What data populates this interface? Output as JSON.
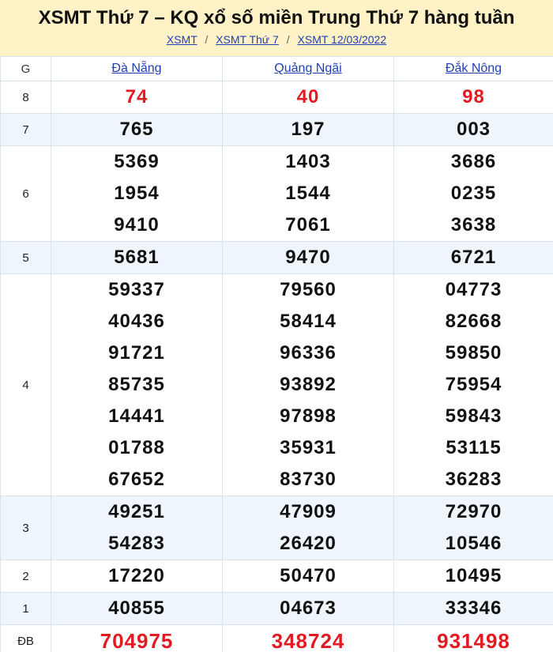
{
  "header": {
    "title": "XSMT Thứ 7 – KQ xổ số miền Trung Thứ 7 hàng tuần",
    "breadcrumbs": [
      "XSMT",
      "XSMT Thứ 7",
      "XSMT 12/03/2022"
    ],
    "separator": "/"
  },
  "table": {
    "prize_header": "G",
    "provinces": [
      "Đà Nẵng",
      "Quảng Ngãi",
      "Đắk Nông"
    ],
    "rows": [
      {
        "label": "8",
        "values": [
          [
            "74"
          ],
          [
            "40"
          ],
          [
            "98"
          ]
        ]
      },
      {
        "label": "7",
        "values": [
          [
            "765"
          ],
          [
            "197"
          ],
          [
            "003"
          ]
        ]
      },
      {
        "label": "6",
        "values": [
          [
            "5369",
            "1954",
            "9410"
          ],
          [
            "1403",
            "1544",
            "7061"
          ],
          [
            "3686",
            "0235",
            "3638"
          ]
        ]
      },
      {
        "label": "5",
        "values": [
          [
            "5681"
          ],
          [
            "9470"
          ],
          [
            "6721"
          ]
        ]
      },
      {
        "label": "4",
        "values": [
          [
            "59337",
            "40436",
            "91721",
            "85735",
            "14441",
            "01788",
            "67652"
          ],
          [
            "79560",
            "58414",
            "96336",
            "93892",
            "97898",
            "35931",
            "83730"
          ],
          [
            "04773",
            "82668",
            "59850",
            "75954",
            "59843",
            "53115",
            "36283"
          ]
        ]
      },
      {
        "label": "3",
        "values": [
          [
            "49251",
            "54283"
          ],
          [
            "47909",
            "26420"
          ],
          [
            "72970",
            "10546"
          ]
        ]
      },
      {
        "label": "2",
        "values": [
          [
            "17220"
          ],
          [
            "50470"
          ],
          [
            "10495"
          ]
        ]
      },
      {
        "label": "1",
        "values": [
          [
            "40855"
          ],
          [
            "04673"
          ],
          [
            "33346"
          ]
        ]
      },
      {
        "label": "ĐB",
        "values": [
          [
            "704975"
          ],
          [
            "348724"
          ],
          [
            "931498"
          ]
        ]
      }
    ]
  },
  "colors": {
    "header_bg": "#fff2c6",
    "alt_row_bg": "#eef5fc",
    "highlight_red": "#e11b22",
    "link_blue": "#1f3fb6"
  }
}
